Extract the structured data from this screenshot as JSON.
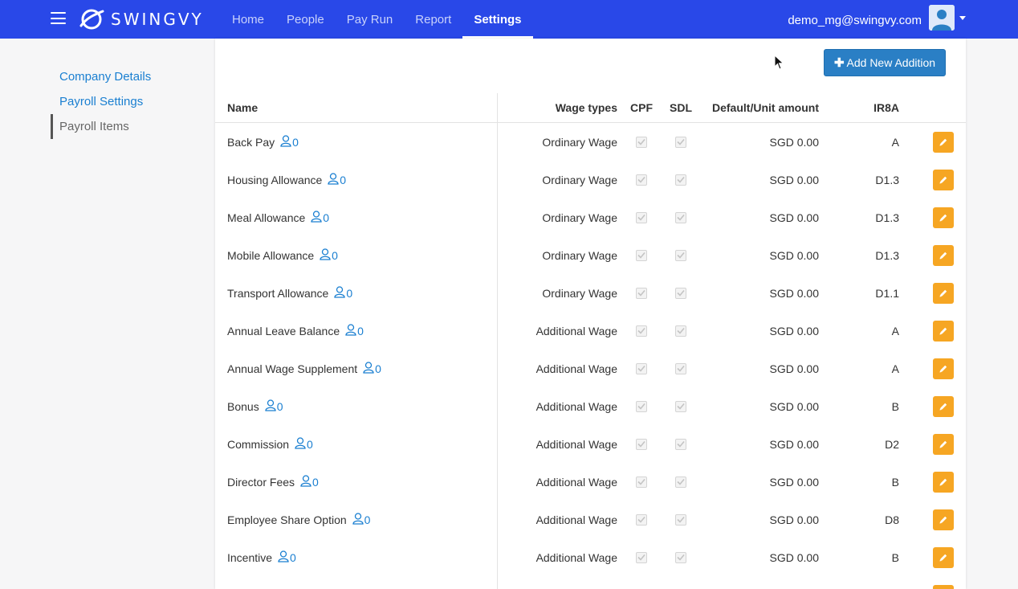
{
  "header": {
    "logo_text": "SWINGVY",
    "tabs": [
      {
        "label": "Home"
      },
      {
        "label": "People"
      },
      {
        "label": "Pay Run"
      },
      {
        "label": "Report"
      },
      {
        "label": "Settings"
      }
    ],
    "active_tab": "Settings",
    "user_email": "demo_mg@swingvy.com"
  },
  "sidebar": {
    "items": [
      {
        "label": "Company Details"
      },
      {
        "label": "Payroll Settings"
      },
      {
        "label": "Payroll Items"
      }
    ],
    "active_item": "Payroll Items"
  },
  "toolbar": {
    "add_label": "Add New Addition"
  },
  "table": {
    "columns": {
      "name": "Name",
      "wage": "Wage types",
      "cpf": "CPF",
      "sdl": "SDL",
      "amount": "Default/Unit amount",
      "ir8a": "IR8A"
    },
    "rows": [
      {
        "name": "Back Pay",
        "count": "0",
        "wage": "Ordinary Wage",
        "cpf": true,
        "sdl": true,
        "amount": "SGD 0.00",
        "ir8a": "A"
      },
      {
        "name": "Housing Allowance",
        "count": "0",
        "wage": "Ordinary Wage",
        "cpf": true,
        "sdl": true,
        "amount": "SGD 0.00",
        "ir8a": "D1.3"
      },
      {
        "name": "Meal Allowance",
        "count": "0",
        "wage": "Ordinary Wage",
        "cpf": true,
        "sdl": true,
        "amount": "SGD 0.00",
        "ir8a": "D1.3"
      },
      {
        "name": "Mobile Allowance",
        "count": "0",
        "wage": "Ordinary Wage",
        "cpf": true,
        "sdl": true,
        "amount": "SGD 0.00",
        "ir8a": "D1.3"
      },
      {
        "name": "Transport Allowance",
        "count": "0",
        "wage": "Ordinary Wage",
        "cpf": true,
        "sdl": true,
        "amount": "SGD 0.00",
        "ir8a": "D1.1"
      },
      {
        "name": "Annual Leave Balance",
        "count": "0",
        "wage": "Additional Wage",
        "cpf": true,
        "sdl": true,
        "amount": "SGD 0.00",
        "ir8a": "A"
      },
      {
        "name": "Annual Wage Supplement",
        "count": "0",
        "wage": "Additional Wage",
        "cpf": true,
        "sdl": true,
        "amount": "SGD 0.00",
        "ir8a": "A"
      },
      {
        "name": "Bonus",
        "count": "0",
        "wage": "Additional Wage",
        "cpf": true,
        "sdl": true,
        "amount": "SGD 0.00",
        "ir8a": "B"
      },
      {
        "name": "Commission",
        "count": "0",
        "wage": "Additional Wage",
        "cpf": true,
        "sdl": true,
        "amount": "SGD 0.00",
        "ir8a": "D2"
      },
      {
        "name": "Director Fees",
        "count": "0",
        "wage": "Additional Wage",
        "cpf": true,
        "sdl": true,
        "amount": "SGD 0.00",
        "ir8a": "B"
      },
      {
        "name": "Employee Share Option",
        "count": "0",
        "wage": "Additional Wage",
        "cpf": true,
        "sdl": true,
        "amount": "SGD 0.00",
        "ir8a": "D8"
      },
      {
        "name": "Incentive",
        "count": "0",
        "wage": "Additional Wage",
        "cpf": true,
        "sdl": true,
        "amount": "SGD 0.00",
        "ir8a": "B"
      },
      {
        "name": "",
        "count": "",
        "wage": "",
        "cpf": true,
        "sdl": true,
        "amount": "",
        "ir8a": ""
      }
    ]
  },
  "colors": {
    "navbar": "#2948e8",
    "link": "#1a7fd1",
    "primary_button": "#2a7fc5",
    "edit_button": "#f6a623"
  },
  "icons": [
    "menu-icon",
    "swingvy-logo-icon",
    "avatar-icon",
    "caret-down-icon",
    "plus-icon",
    "user-icon",
    "checkbox-icon",
    "pencil-icon",
    "mouse-cursor-icon"
  ]
}
